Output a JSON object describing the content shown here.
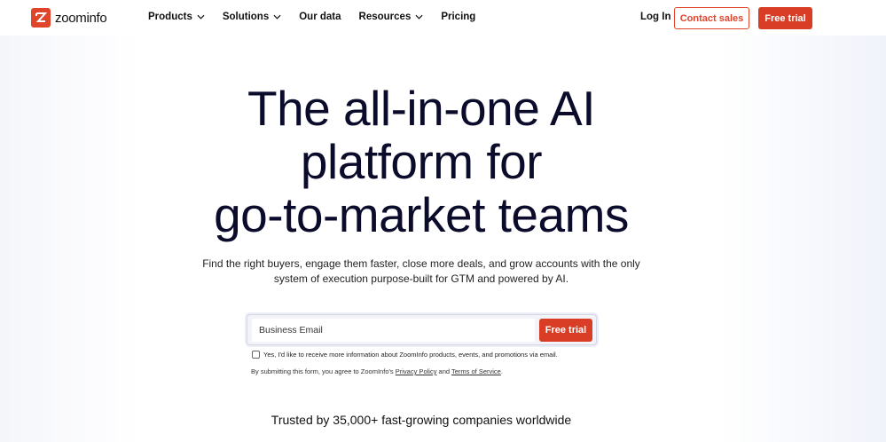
{
  "brand": {
    "name": "zoominfo",
    "accent": "#d93d25"
  },
  "nav": {
    "items": [
      {
        "label": "Products",
        "has_dropdown": true
      },
      {
        "label": "Solutions",
        "has_dropdown": true
      },
      {
        "label": "Our data",
        "has_dropdown": false
      },
      {
        "label": "Resources",
        "has_dropdown": true
      },
      {
        "label": "Pricing",
        "has_dropdown": false
      }
    ],
    "login": "Log In",
    "contact_sales": "Contact sales",
    "free_trial": "Free trial"
  },
  "hero": {
    "title_lines": [
      "The all-in-one AI",
      "platform for",
      "go-to-market teams"
    ],
    "subtitle_line1": "Find the right buyers, engage them faster, close more deals, and grow accounts with the only",
    "subtitle_line2": "system of execution purpose-built for GTM and powered by AI."
  },
  "form": {
    "email_placeholder": "Business Email",
    "submit_label": "Free trial",
    "consent_text": "Yes, I'd like to receive more information about ZoomInfo products, events, and promotions via email.",
    "legal_prefix": "By submitting this form, you agree to ZoomInfo's ",
    "privacy_label": "Privacy Policy",
    "legal_and": " and ",
    "terms_label": "Terms of Service",
    "legal_suffix": "."
  },
  "trusted": "Trusted by 35,000+ fast-growing companies worldwide"
}
